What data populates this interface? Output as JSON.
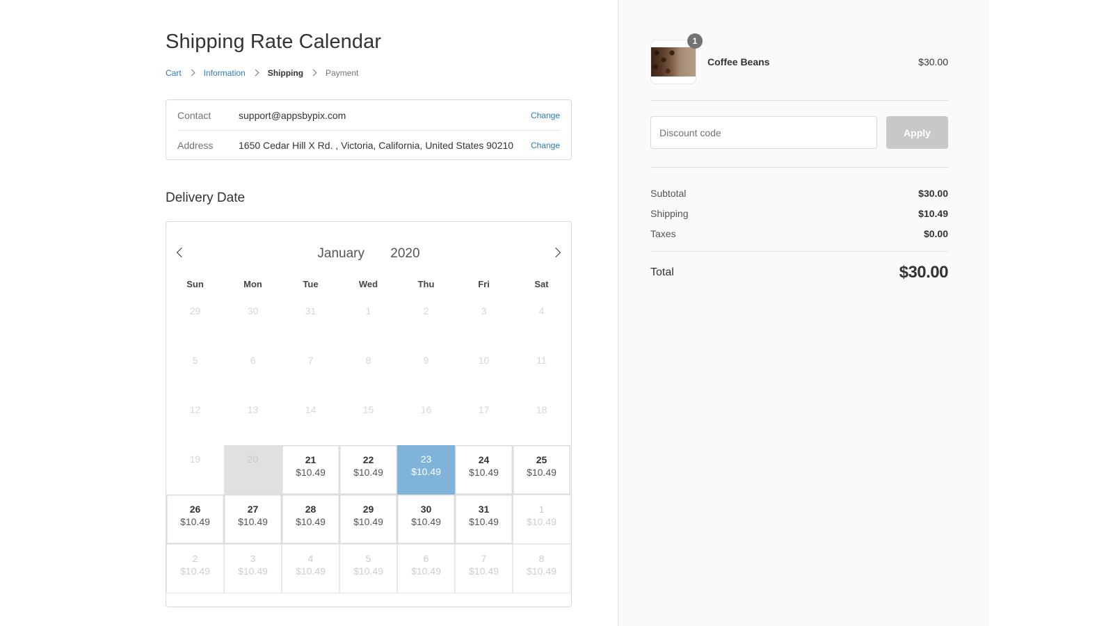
{
  "page": {
    "title": "Shipping Rate Calendar"
  },
  "breadcrumb": {
    "items": [
      {
        "label": "Cart",
        "state": "link"
      },
      {
        "label": "Information",
        "state": "link"
      },
      {
        "label": "Shipping",
        "state": "current"
      },
      {
        "label": "Payment",
        "state": "future"
      }
    ]
  },
  "review": {
    "contact_label": "Contact",
    "contact_value": "support@appsbypix.com",
    "contact_change": "Change",
    "address_label": "Address",
    "address_value": "1650 Cedar Hill X Rd. , Victoria, California, United States 90210",
    "address_change": "Change"
  },
  "delivery": {
    "section_title": "Delivery Date",
    "month": "January",
    "year": "2020",
    "weekdays": [
      "Sun",
      "Mon",
      "Tue",
      "Wed",
      "Thu",
      "Fri",
      "Sat"
    ],
    "weeks": [
      [
        {
          "day": "29",
          "price": "",
          "state": "disabled"
        },
        {
          "day": "30",
          "price": "",
          "state": "disabled"
        },
        {
          "day": "31",
          "price": "",
          "state": "disabled"
        },
        {
          "day": "1",
          "price": "",
          "state": "disabled"
        },
        {
          "day": "2",
          "price": "",
          "state": "disabled"
        },
        {
          "day": "3",
          "price": "",
          "state": "disabled"
        },
        {
          "day": "4",
          "price": "",
          "state": "disabled"
        }
      ],
      [
        {
          "day": "5",
          "price": "",
          "state": "disabled"
        },
        {
          "day": "6",
          "price": "",
          "state": "disabled"
        },
        {
          "day": "7",
          "price": "",
          "state": "disabled"
        },
        {
          "day": "8",
          "price": "",
          "state": "disabled"
        },
        {
          "day": "9",
          "price": "",
          "state": "disabled"
        },
        {
          "day": "10",
          "price": "",
          "state": "disabled"
        },
        {
          "day": "11",
          "price": "",
          "state": "disabled"
        }
      ],
      [
        {
          "day": "12",
          "price": "",
          "state": "disabled"
        },
        {
          "day": "13",
          "price": "",
          "state": "disabled"
        },
        {
          "day": "14",
          "price": "",
          "state": "disabled"
        },
        {
          "day": "15",
          "price": "",
          "state": "disabled"
        },
        {
          "day": "16",
          "price": "",
          "state": "disabled"
        },
        {
          "day": "17",
          "price": "",
          "state": "disabled"
        },
        {
          "day": "18",
          "price": "",
          "state": "disabled"
        }
      ],
      [
        {
          "day": "19",
          "price": "",
          "state": "disabled"
        },
        {
          "day": "20",
          "price": "",
          "state": "today"
        },
        {
          "day": "21",
          "price": "$10.49",
          "state": "available"
        },
        {
          "day": "22",
          "price": "$10.49",
          "state": "available"
        },
        {
          "day": "23",
          "price": "$10.49",
          "state": "selected"
        },
        {
          "day": "24",
          "price": "$10.49",
          "state": "available"
        },
        {
          "day": "25",
          "price": "$10.49",
          "state": "available"
        }
      ],
      [
        {
          "day": "26",
          "price": "$10.49",
          "state": "available"
        },
        {
          "day": "27",
          "price": "$10.49",
          "state": "available"
        },
        {
          "day": "28",
          "price": "$10.49",
          "state": "available"
        },
        {
          "day": "29",
          "price": "$10.49",
          "state": "available"
        },
        {
          "day": "30",
          "price": "$10.49",
          "state": "available"
        },
        {
          "day": "31",
          "price": "$10.49",
          "state": "available"
        },
        {
          "day": "1",
          "price": "$10.49",
          "state": "outside"
        }
      ],
      [
        {
          "day": "2",
          "price": "$10.49",
          "state": "outside"
        },
        {
          "day": "3",
          "price": "$10.49",
          "state": "outside"
        },
        {
          "day": "4",
          "price": "$10.49",
          "state": "outside"
        },
        {
          "day": "5",
          "price": "$10.49",
          "state": "outside"
        },
        {
          "day": "6",
          "price": "$10.49",
          "state": "outside"
        },
        {
          "day": "7",
          "price": "$10.49",
          "state": "outside"
        },
        {
          "day": "8",
          "price": "$10.49",
          "state": "outside"
        }
      ]
    ],
    "selected_color": "#7fb3da"
  },
  "order": {
    "product_name": "Coffee Beans",
    "product_price": "$30.00",
    "quantity": "1",
    "discount_placeholder": "Discount code",
    "apply_label": "Apply",
    "subtotal_label": "Subtotal",
    "subtotal_value": "$30.00",
    "shipping_label": "Shipping",
    "shipping_value": "$10.49",
    "taxes_label": "Taxes",
    "taxes_value": "$0.00",
    "total_label": "Total",
    "total_value": "$30.00"
  },
  "colors": {
    "link": "#2a7ab5",
    "sidebar_bg": "#fafafa",
    "apply_bg": "#c8c8c8"
  }
}
